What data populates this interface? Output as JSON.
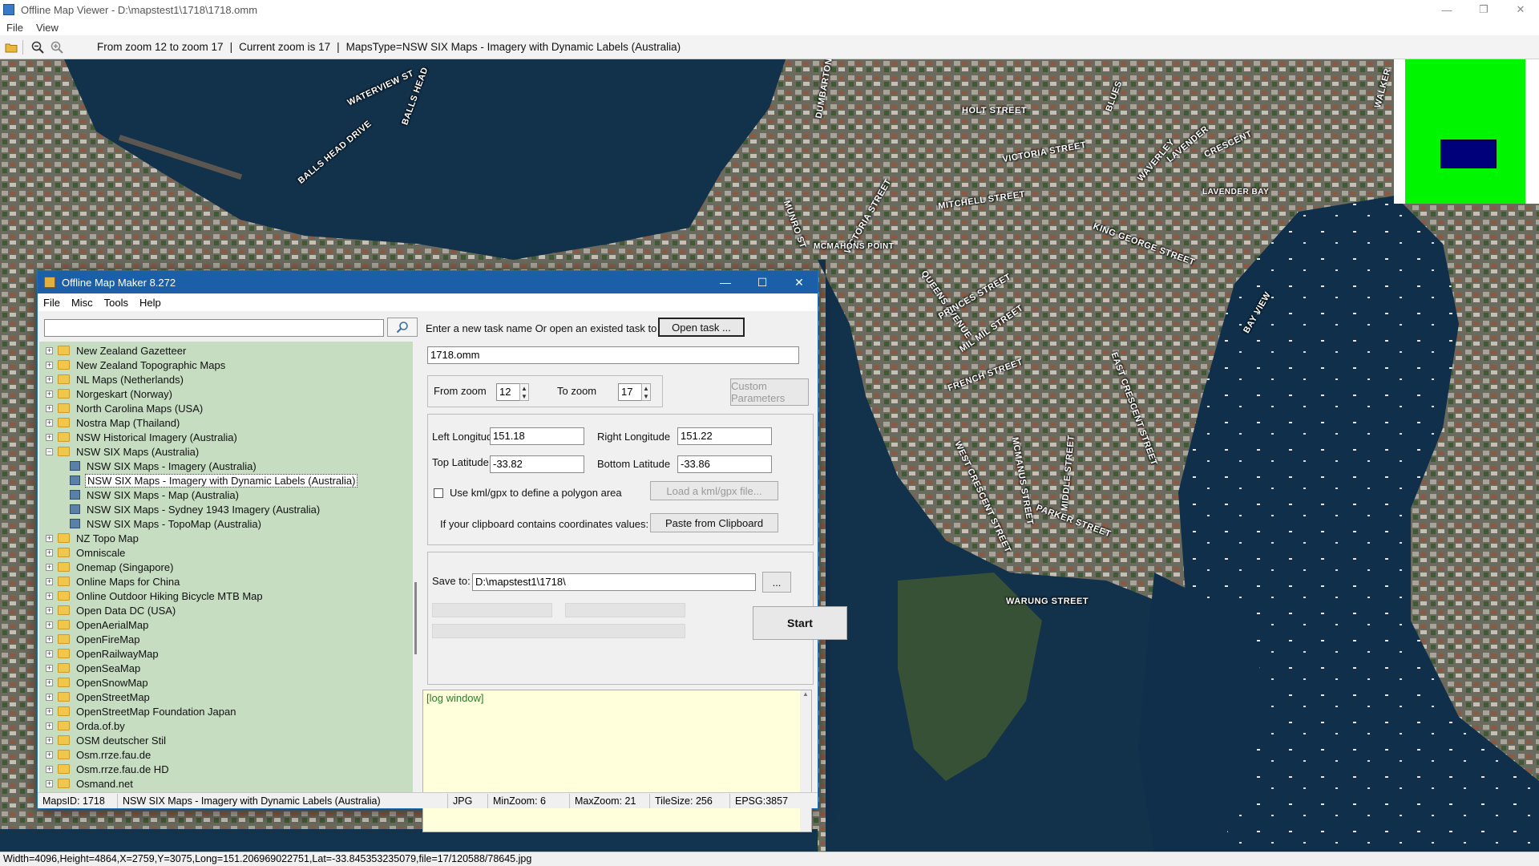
{
  "outer_window": {
    "title": "Offline Map Viewer - D:\\mapstest1\\1718\\1718.omm",
    "controls": {
      "minimize": "—",
      "maximize": "❐",
      "close": "✕"
    },
    "menu": [
      "File",
      "View"
    ],
    "toolbar": {
      "info_zoom_range": "From zoom 12 to zoom 17",
      "info_sep": "|",
      "info_current_zoom": "Current zoom is 17",
      "info_maps_type": "MapsType=NSW SIX Maps - Imagery with Dynamic Labels (Australia)",
      "icons": [
        "open-folder-icon",
        "zoom-out-icon",
        "zoom-in-icon"
      ]
    },
    "status": "Width=4096,Height=4864,X=2759,Y=3075,Long=151.206969022751,Lat=-33.845353235079,file=17/120588/78645.jpg"
  },
  "map": {
    "street_labels": [
      "WATERVIEW ST",
      "BALLS HEAD",
      "BALLS HEAD DRIVE",
      "DUMBARTON",
      "HOLT STREET",
      "VICTORIA STREET",
      "WAVERLEY",
      "LAVENDER",
      "CRESCENT",
      "LAVENDER BAY",
      "MITCHELL STREET",
      "VICTORIA STREET",
      "MCMAHONS POINT",
      "KING GEORGE STREET",
      "QUEENS AVENUE",
      "PRINCES STREET",
      "MIL MIL STREET",
      "FRENCH STREET",
      "EAST CRESCENT STREET",
      "BAY VIEW",
      "WEST CRESCENT STREET",
      "MCMANUS STREET",
      "MIDDLE STREET",
      "PARKER STREET",
      "WARUNG STREET",
      "BLUES",
      "MUNRO ST",
      "WALKER"
    ],
    "overview_colors": {
      "background": "#00f500",
      "viewport": "#00007a"
    }
  },
  "dialog": {
    "title": "Offline Map Maker 8.272",
    "controls": {
      "minimize": "—",
      "maximize": "☐",
      "close": "✕"
    },
    "menu": [
      "File",
      "Misc",
      "Tools",
      "Help"
    ],
    "search": {
      "value": "",
      "icon": "search-icon"
    },
    "tree": [
      {
        "label": "New Zealand Gazetteer",
        "type": "folder",
        "level": 0,
        "expander": "+"
      },
      {
        "label": "New Zealand Topographic Maps",
        "type": "folder",
        "level": 0,
        "expander": "+"
      },
      {
        "label": "NL Maps (Netherlands)",
        "type": "folder",
        "level": 0,
        "expander": "+"
      },
      {
        "label": "Norgeskart (Norway)",
        "type": "folder",
        "level": 0,
        "expander": "+"
      },
      {
        "label": "North Carolina Maps (USA)",
        "type": "folder",
        "level": 0,
        "expander": "+"
      },
      {
        "label": "Nostra Map (Thailand)",
        "type": "folder",
        "level": 0,
        "expander": "+"
      },
      {
        "label": "NSW Historical Imagery (Australia)",
        "type": "folder",
        "level": 0,
        "expander": "+"
      },
      {
        "label": "NSW SIX Maps (Australia)",
        "type": "folder-open",
        "level": 0,
        "expander": "−"
      },
      {
        "label": "NSW SIX Maps - Imagery (Australia)",
        "type": "map",
        "level": 1
      },
      {
        "label": "NSW SIX Maps - Imagery with Dynamic Labels (Australia)",
        "type": "map",
        "level": 1,
        "selected": true
      },
      {
        "label": "NSW SIX Maps - Map (Australia)",
        "type": "map",
        "level": 1
      },
      {
        "label": "NSW SIX Maps - Sydney 1943 Imagery (Australia)",
        "type": "map",
        "level": 1
      },
      {
        "label": "NSW SIX Maps - TopoMap (Australia)",
        "type": "map",
        "level": 1
      },
      {
        "label": "NZ Topo Map",
        "type": "folder",
        "level": 0,
        "expander": "+"
      },
      {
        "label": "Omniscale",
        "type": "folder",
        "level": 0,
        "expander": "+"
      },
      {
        "label": "Onemap (Singapore)",
        "type": "folder",
        "level": 0,
        "expander": "+"
      },
      {
        "label": "Online Maps for China",
        "type": "folder",
        "level": 0,
        "expander": "+"
      },
      {
        "label": "Online Outdoor Hiking Bicycle MTB Map",
        "type": "folder",
        "level": 0,
        "expander": "+"
      },
      {
        "label": "Open Data DC (USA)",
        "type": "folder",
        "level": 0,
        "expander": "+"
      },
      {
        "label": "OpenAerialMap",
        "type": "folder",
        "level": 0,
        "expander": "+"
      },
      {
        "label": "OpenFireMap",
        "type": "folder",
        "level": 0,
        "expander": "+"
      },
      {
        "label": "OpenRailwayMap",
        "type": "folder",
        "level": 0,
        "expander": "+"
      },
      {
        "label": "OpenSeaMap",
        "type": "folder",
        "level": 0,
        "expander": "+"
      },
      {
        "label": "OpenSnowMap",
        "type": "folder",
        "level": 0,
        "expander": "+"
      },
      {
        "label": "OpenStreetMap",
        "type": "folder",
        "level": 0,
        "expander": "+"
      },
      {
        "label": "OpenStreetMap Foundation Japan",
        "type": "folder",
        "level": 0,
        "expander": "+"
      },
      {
        "label": "Orda.of.by",
        "type": "folder",
        "level": 0,
        "expander": "+"
      },
      {
        "label": "OSM deutscher Stil",
        "type": "folder",
        "level": 0,
        "expander": "+"
      },
      {
        "label": "Osm.rrze.fau.de",
        "type": "folder",
        "level": 0,
        "expander": "+"
      },
      {
        "label": "Osm.rrze.fau.de HD",
        "type": "folder",
        "level": 0,
        "expander": "+"
      },
      {
        "label": "Osmand.net",
        "type": "folder",
        "level": 0,
        "expander": "+"
      }
    ],
    "task": {
      "prompt": "Enter a new task name Or open an existed task to continue:",
      "open_button": "Open task ...",
      "name_value": "1718.omm"
    },
    "zoom": {
      "from_label": "From zoom",
      "from_value": "12",
      "to_label": "To zoom",
      "to_value": "17",
      "custom_button": "Custom Parameters"
    },
    "area": {
      "left_lon_label": "Left Longitude",
      "left_lon_value": "151.18",
      "right_lon_label": "Right Longitude",
      "right_lon_value": "151.22",
      "top_lat_label": "Top Latitude",
      "top_lat_value": "-33.82",
      "bottom_lat_label": "Bottom Latitude",
      "bottom_lat_value": "-33.86",
      "kml_checkbox_label": "Use kml/gpx to define a polygon area",
      "kml_checked": false,
      "load_kml_button": "Load a kml/gpx file...",
      "clipboard_label": "If your clipboard contains coordinates values:",
      "paste_button": "Paste from Clipboard"
    },
    "save": {
      "label": "Save to:",
      "value": "D:\\mapstest1\\1718\\",
      "browse_button": "...",
      "start_button": "Start"
    },
    "log": {
      "text": "[log window]"
    },
    "status": {
      "maps_id": "MapsID: 1718",
      "maps_name": "NSW SIX Maps - Imagery with Dynamic Labels (Australia)",
      "format": "JPG",
      "min_zoom": "MinZoom: 6",
      "max_zoom": "MaxZoom: 21",
      "tile_size": "TileSize: 256",
      "epsg": "EPSG:3857"
    }
  }
}
